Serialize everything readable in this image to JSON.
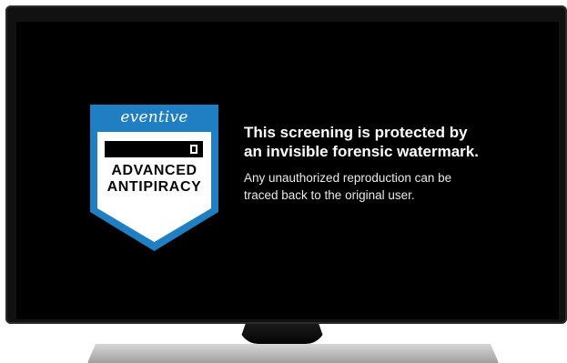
{
  "badge": {
    "brand": "eventive",
    "title_line1": "ADVANCED",
    "title_line2": "ANTIPIRACY",
    "icon": "shield-icon",
    "colors": {
      "shield_blue": "#1f7fc2",
      "shield_inner": "#ffffff",
      "bar": "#000000"
    }
  },
  "message": {
    "headline_line1": "This screening is protected by",
    "headline_line2": "an invisible forensic watermark.",
    "body_line1": "Any unauthorized reproduction can be",
    "body_line2": "traced back to the original user."
  }
}
